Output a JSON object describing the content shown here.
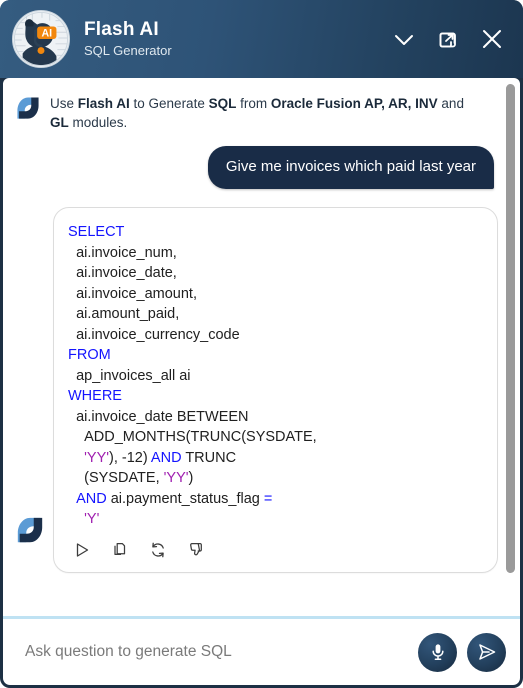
{
  "header": {
    "title": "Flash AI",
    "subtitle": "SQL Generator",
    "avatar_icon": "flash-ai-dog-mascot-logo",
    "actions": [
      {
        "name": "minimize-chevron-down-icon",
        "label": "Minimize"
      },
      {
        "name": "expand-window-icon",
        "label": "Expand"
      },
      {
        "name": "close-icon",
        "label": "Close"
      }
    ]
  },
  "intro": {
    "logo_icon": "flash-brand-mark-icon",
    "parts": [
      {
        "text": "Use ",
        "bold": false
      },
      {
        "text": "Flash AI",
        "bold": true
      },
      {
        "text": " to Generate ",
        "bold": false
      },
      {
        "text": "SQL",
        "bold": true
      },
      {
        "text": " from ",
        "bold": false
      },
      {
        "text": "Oracle Fusion AP, AR, INV",
        "bold": true
      },
      {
        "text": " and ",
        "bold": false
      },
      {
        "text": "GL",
        "bold": true
      },
      {
        "text": " modules.",
        "bold": false
      }
    ],
    "plain": "Use Flash AI to Generate SQL from Oracle Fusion AP, AR, INV and GL modules."
  },
  "conversation": {
    "user_message": "Give me invoices which paid last year",
    "assistant_code_lines": [
      [
        {
          "t": "SELECT",
          "c": "kw"
        }
      ],
      [
        {
          "t": "  ai.invoice_num,",
          "c": ""
        }
      ],
      [
        {
          "t": "  ai.invoice_date,",
          "c": ""
        }
      ],
      [
        {
          "t": "  ai.invoice_amount,",
          "c": ""
        }
      ],
      [
        {
          "t": "  ai.amount_paid,",
          "c": ""
        }
      ],
      [
        {
          "t": "  ai.invoice_currency_code",
          "c": ""
        }
      ],
      [
        {
          "t": "FROM",
          "c": "kw"
        }
      ],
      [
        {
          "t": "  ap_invoices_all ai",
          "c": ""
        }
      ],
      [
        {
          "t": "WHERE",
          "c": "kw"
        }
      ],
      [
        {
          "t": "  ai.invoice_date BETWEEN",
          "c": ""
        }
      ],
      [
        {
          "t": "    ADD_MONTHS(TRUNC(SYSDATE,",
          "c": ""
        }
      ],
      [
        {
          "t": "    ",
          "c": ""
        },
        {
          "t": "'YY'",
          "c": "str"
        },
        {
          "t": "), -12) ",
          "c": ""
        },
        {
          "t": "AND",
          "c": "kw"
        },
        {
          "t": " TRUNC",
          "c": ""
        }
      ],
      [
        {
          "t": "    (SYSDATE, ",
          "c": ""
        },
        {
          "t": "'YY'",
          "c": "str"
        },
        {
          "t": ")",
          "c": ""
        }
      ],
      [
        {
          "t": "  ",
          "c": ""
        },
        {
          "t": "AND",
          "c": "kw"
        },
        {
          "t": " ai.payment_status_flag ",
          "c": ""
        },
        {
          "t": "=",
          "c": "op"
        }
      ],
      [
        {
          "t": "    ",
          "c": ""
        },
        {
          "t": "'Y'",
          "c": "str"
        }
      ]
    ],
    "code_plain": "SELECT\n  ai.invoice_num,\n  ai.invoice_date,\n  ai.invoice_amount,\n  ai.amount_paid,\n  ai.invoice_currency_code\nFROM\n  ap_invoices_all ai\nWHERE\n  ai.invoice_date BETWEEN\n    ADD_MONTHS(TRUNC(SYSDATE, 'YY'), -12) AND TRUNC(SYSDATE, 'YY')\n  AND ai.payment_status_flag = 'Y'",
    "code_actions": [
      {
        "name": "run-query-icon",
        "label": "Run"
      },
      {
        "name": "copy-icon",
        "label": "Copy"
      },
      {
        "name": "regenerate-icon",
        "label": "Regenerate"
      },
      {
        "name": "thumbs-down-icon",
        "label": "Dislike"
      }
    ],
    "bot_avatar_icon": "flash-brand-mark-icon"
  },
  "footer": {
    "input_placeholder": "Ask question to generate SQL",
    "input_value": "",
    "mic_icon": "microphone-icon",
    "send_icon": "send-paper-plane-icon"
  },
  "colors": {
    "header_gradient_start": "#355c80",
    "header_gradient_end": "#1c3650",
    "frame": "#1d3044",
    "user_bubble": "#192c47",
    "divider": "#bfe2f3",
    "keyword": "#1414ff",
    "string": "#a020b0",
    "brand_light": "#5b9bd5",
    "brand_dark": "#1b2f4a",
    "accent_orange": "#f2870d",
    "scrollbar_thumb": "#9a9a9a"
  }
}
